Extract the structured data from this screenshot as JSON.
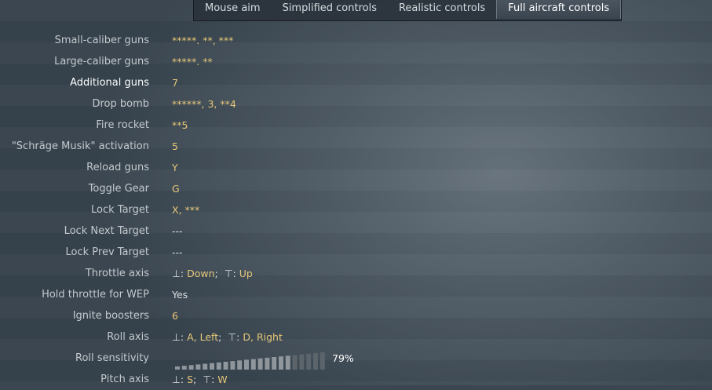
{
  "tabs": [
    {
      "label": "Mouse aim"
    },
    {
      "label": "Simplified controls"
    },
    {
      "label": "Realistic controls"
    },
    {
      "label": "Full aircraft controls",
      "active": true
    }
  ],
  "rows": [
    {
      "label": "Small-caliber guns",
      "value": "*****. **, ***"
    },
    {
      "label": "Large-caliber guns",
      "value": "*****. **"
    },
    {
      "label": "Additional guns",
      "value": "7"
    },
    {
      "label": "Drop bomb",
      "value": "******, 3, **4"
    },
    {
      "label": "Fire rocket",
      "value": "**5"
    },
    {
      "label": "\"Schräge Musik\" activation",
      "value": "5"
    },
    {
      "label": "Reload guns",
      "value": "Y"
    },
    {
      "label": "Toggle Gear",
      "value": "G"
    },
    {
      "label": "Lock Target",
      "value": "X, ***"
    },
    {
      "label": "Lock Next Target",
      "value": "---"
    },
    {
      "label": "Lock Prev Target",
      "value": "---"
    },
    {
      "label": "Throttle axis",
      "down": "Down",
      "up": "Up"
    },
    {
      "label": "Hold throttle for WEP",
      "value": "Yes"
    },
    {
      "label": "Ignite boosters",
      "value": "6"
    },
    {
      "label": "Roll axis",
      "down": "A, Left",
      "up": "D, Right"
    },
    {
      "label": "Roll sensitivity",
      "percent": "79%",
      "level": 0.79
    },
    {
      "label": "Pitch axis",
      "down": "S",
      "up": "W"
    }
  ],
  "colors": {
    "value": "#e6c77a",
    "label": "#c4c9ce",
    "accent": "#ffffff"
  },
  "icons": {
    "axis_down": "axis-down-icon",
    "axis_up": "axis-up-icon"
  }
}
